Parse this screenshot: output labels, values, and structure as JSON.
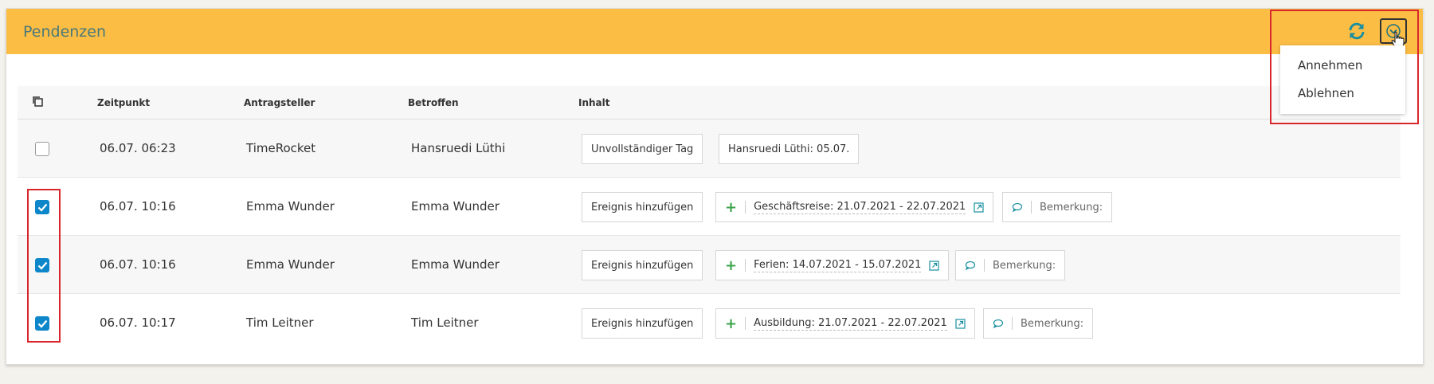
{
  "panel": {
    "title": "Pendenzen"
  },
  "menu": {
    "items": [
      "Annehmen",
      "Ablehnen"
    ]
  },
  "table": {
    "headers": {
      "time": "Zeitpunkt",
      "applicant": "Antragsteller",
      "affected": "Betroffen",
      "content": "Inhalt"
    },
    "rows": [
      {
        "checked": false,
        "time": "06.07. 06:23",
        "applicant": "TimeRocket",
        "affected": "Hansruedi Lüthi",
        "chip1": "Unvollständiger Tag",
        "chip2": "Hansruedi Lüthi: 05.07."
      },
      {
        "checked": true,
        "time": "06.07. 10:16",
        "applicant": "Emma Wunder",
        "affected": "Emma Wunder",
        "action": "Ereignis hinzufügen",
        "event": "Geschäftsreise: 21.07.2021 - 22.07.2021",
        "remark": "Bemerkung:"
      },
      {
        "checked": true,
        "time": "06.07. 10:16",
        "applicant": "Emma Wunder",
        "affected": "Emma Wunder",
        "action": "Ereignis hinzufügen",
        "event": "Ferien: 14.07.2021 - 15.07.2021",
        "remark": "Bemerkung:"
      },
      {
        "checked": true,
        "time": "06.07. 10:17",
        "applicant": "Tim Leitner",
        "affected": "Tim Leitner",
        "action": "Ereignis hinzufügen",
        "event": "Ausbildung: 21.07.2021 - 22.07.2021",
        "remark": "Bemerkung:"
      }
    ]
  },
  "colors": {
    "header_bg": "#fbbd44",
    "title": "#49797a",
    "accent_blue": "#0d87c9",
    "plus_green": "#3aa34a",
    "highlight_red": "#d9262c"
  },
  "icons": {
    "refresh": "refresh-icon",
    "dropdown": "chevron-down-circle-icon",
    "select_all": "copy-icon",
    "comment": "comment-icon",
    "external": "external-link-icon"
  }
}
